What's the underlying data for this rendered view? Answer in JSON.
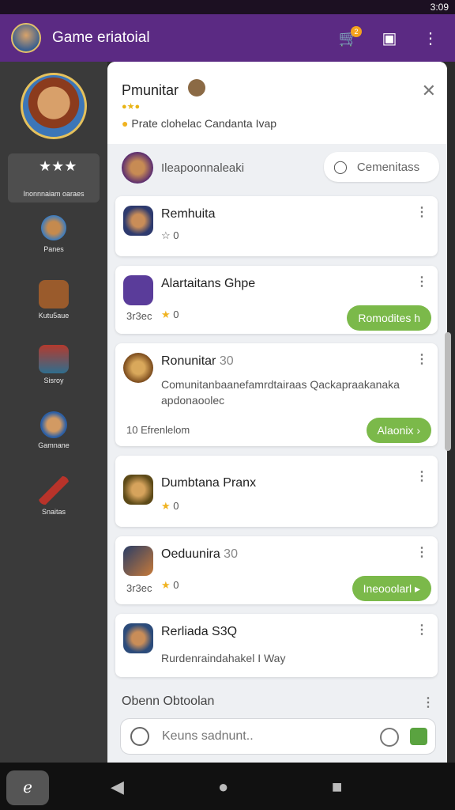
{
  "status_bar": {
    "time": "3:09"
  },
  "app_bar": {
    "title": "Game eriatoial",
    "cart_badge": "2"
  },
  "sidebar": {
    "items": [
      {
        "label": "Inonnnaiam oaraes",
        "icon": "stars-icon"
      },
      {
        "label": "Panes",
        "icon": "character-icon"
      },
      {
        "label": "Kutu5aue",
        "icon": "cart-icon"
      },
      {
        "label": "Sisroy",
        "icon": "chest-icon"
      },
      {
        "label": "Gamnane",
        "icon": "profile-icon"
      },
      {
        "label": "Snaitas",
        "icon": "weapon-icon"
      }
    ]
  },
  "header": {
    "title": "Pmunitar",
    "subtitle": "Prate clohelac Candanta Ivap"
  },
  "search_row": {
    "name": "Ileapoonnaleaki",
    "button_label": "Cemenitass"
  },
  "cards": [
    {
      "name": "Remhuita",
      "count": "0"
    },
    {
      "name": "Alartaitans Ghpe",
      "count": "0",
      "meta": "3r3ec",
      "action": "Romodites h"
    },
    {
      "name": "Ronunitar",
      "name_suffix": "30",
      "body": "Comunitanbaanefamrdtairaas Qackapraakanaka apdonaoolec",
      "meta": "10 Efrenlelom",
      "action": "Alaonix"
    },
    {
      "name": "Dumbtana Pranx",
      "count": "0"
    },
    {
      "name": "Oeduunira",
      "name_suffix": "30",
      "count": "0",
      "meta": "3r3ec",
      "action": "Ineooolarl"
    },
    {
      "name": "Rerliada S3Q",
      "body": "Rurdenraindahakel I Way"
    }
  ],
  "composer": {
    "label": "Obenn Obtoolan",
    "placeholder": "Keuns sadnunt.."
  },
  "colors": {
    "accent": "#5b2a83",
    "action": "#7bb94a",
    "star": "#f0b321"
  }
}
